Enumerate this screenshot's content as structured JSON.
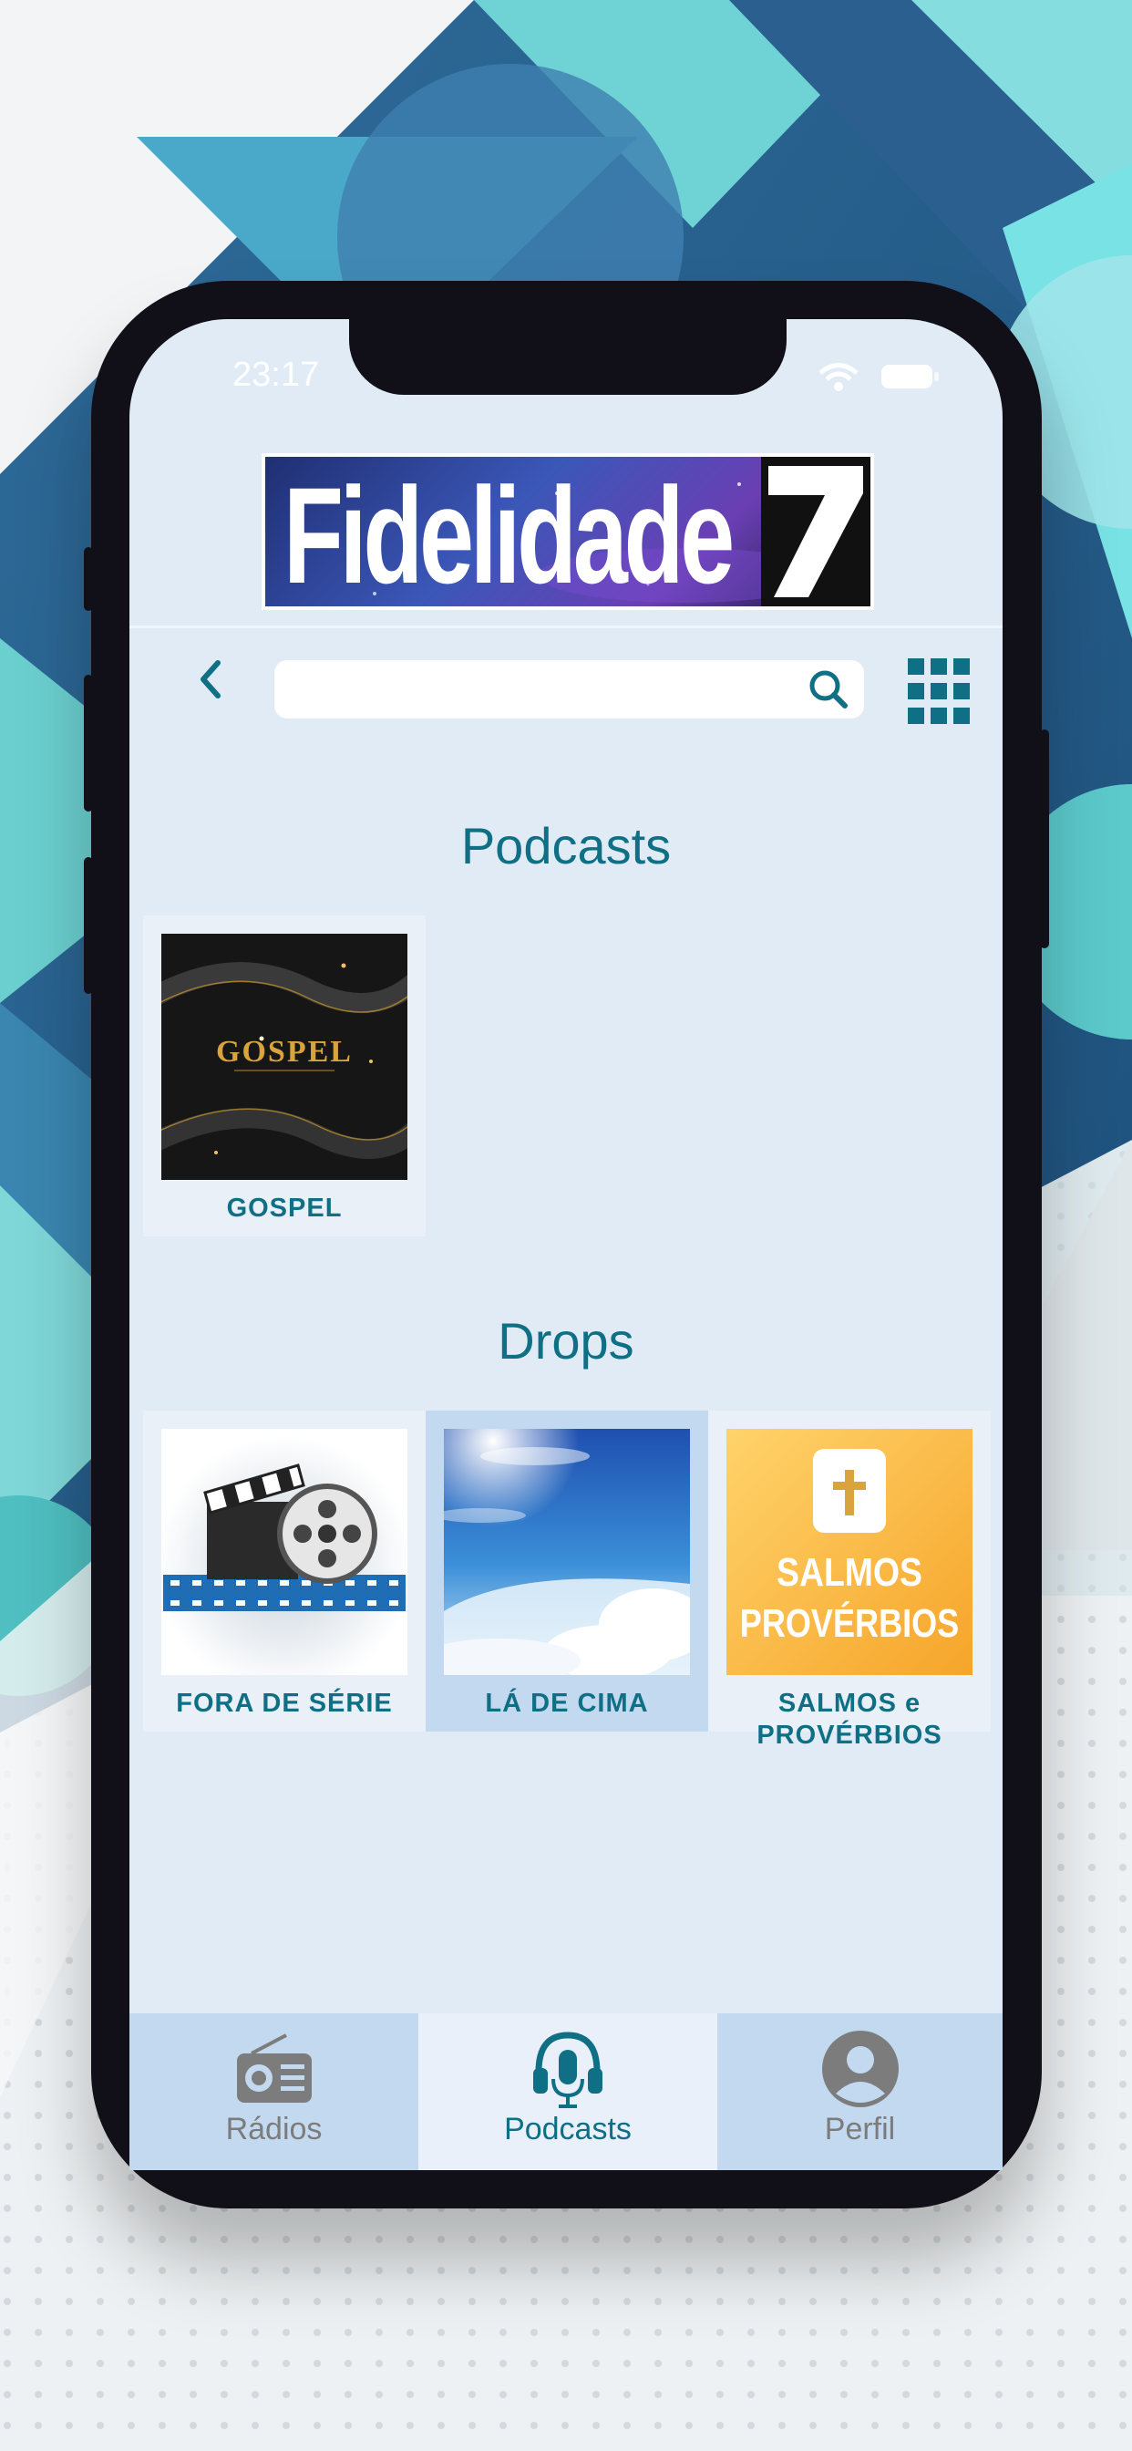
{
  "status_bar": {
    "time": "23:17",
    "wifi_icon": "wifi-icon",
    "battery_icon": "battery-icon"
  },
  "header": {
    "logo_text": "Fidelidade",
    "logo_number": "7"
  },
  "search": {
    "value": "",
    "placeholder": "",
    "back_icon": "chevron-left-icon",
    "search_icon": "search-icon",
    "grid_icon": "grid-icon"
  },
  "sections": [
    {
      "title": "Podcasts",
      "items": [
        {
          "label": "GOSPEL",
          "image_text": "GOSPEL"
        }
      ]
    },
    {
      "title": "Drops",
      "items": [
        {
          "label": "FORA DE SÉRIE"
        },
        {
          "label": "LÁ DE CIMA",
          "selected": true
        },
        {
          "label": "SALMOS e PROVÉRBIOS",
          "image_text_1": "SALMOS",
          "image_text_2": "PROVÉRBIOS"
        }
      ]
    }
  ],
  "tabbar": {
    "items": [
      {
        "label": "Rádios",
        "icon": "radio-icon"
      },
      {
        "label": "Podcasts",
        "icon": "headphones-mic-icon",
        "active": true
      },
      {
        "label": "Perfil",
        "icon": "user-icon"
      }
    ]
  },
  "colors": {
    "accent": "#0f6f85",
    "screen_bg": "#e0ebf6",
    "tab_bg": "#c3d9f0",
    "tab_active_bg": "#e9f0f9",
    "phone_frame": "#111018"
  }
}
